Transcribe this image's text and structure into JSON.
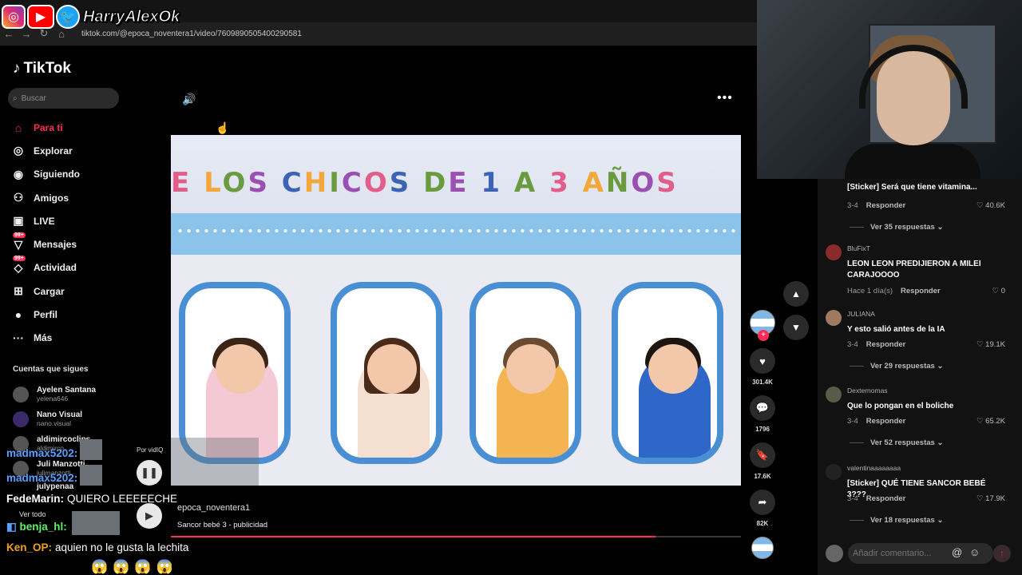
{
  "browser": {
    "url": "tiktok.com/@epoca_noventera1/video/7609890505400290581"
  },
  "overlay": {
    "handle": "HarryAlexOk"
  },
  "tiktok": {
    "logo": "TikTok",
    "search_placeholder": "Buscar",
    "menu": [
      {
        "label": "Para ti",
        "icon": "home-icon"
      },
      {
        "label": "Explorar",
        "icon": "compass-icon"
      },
      {
        "label": "Siguiendo",
        "icon": "following-icon"
      },
      {
        "label": "Amigos",
        "icon": "friends-icon"
      },
      {
        "label": "LIVE",
        "icon": "live-icon"
      },
      {
        "label": "Mensajes",
        "icon": "messages-icon",
        "badge": "99+"
      },
      {
        "label": "Actividad",
        "icon": "activity-icon",
        "badge": "99+"
      },
      {
        "label": "Cargar",
        "icon": "upload-icon"
      },
      {
        "label": "Perfil",
        "icon": "profile-icon"
      },
      {
        "label": "Más",
        "icon": "more-icon"
      }
    ],
    "follows_title": "Cuentas que sigues",
    "follows": [
      {
        "name": "Ayelen Santana",
        "user": "yelena646"
      },
      {
        "name": "Nano Visual",
        "user": "nano.visual"
      },
      {
        "name": "aldimircoclips",
        "user": "aldimirco"
      },
      {
        "name": "Juli Manzotti",
        "user": "julimanzotti"
      },
      {
        "name": "julypenaa",
        "user": "julypenaa"
      }
    ],
    "ver_todo": "Ver todo"
  },
  "video": {
    "title_text": "E LOS CHICOS DE 1 A 3 AÑOS",
    "author": "epoca_noventera1",
    "description": "Sancor bebé 3 - publicidad",
    "progress": 0.85,
    "likes": "301.4K",
    "comments": "1796",
    "saves": "17.6K",
    "shares": "82K"
  },
  "comments": [
    {
      "user": "",
      "text": "[Sticker] Será que tiene vitamina...",
      "meta": "3-4",
      "reply": "Responder",
      "likes": "40.6K",
      "replies": "Ver 35 respuestas"
    },
    {
      "user": "BluFixT",
      "text": "LEON LEON PREDIJIERON A MILEI CARAJOOOO",
      "meta": "Hace 1 día(s)",
      "reply": "Responder",
      "likes": "0",
      "replies": ""
    },
    {
      "user": "JULIANA",
      "text": "Y esto salió antes de la IA",
      "meta": "3-4",
      "reply": "Responder",
      "likes": "19.1K",
      "replies": "Ver 29 respuestas"
    },
    {
      "user": "Dexternomas",
      "text": "Que lo pongan en el boliche",
      "meta": "3-4",
      "reply": "Responder",
      "likes": "65.2K",
      "replies": "Ver 52 respuestas"
    },
    {
      "user": "valentinaaaaaaaa",
      "text": "[Sticker] QUÉ TIENE SANCOR BEBÉ 3???",
      "meta": "3-4",
      "reply": "Responder",
      "likes": "17.9K",
      "replies": "Ver 18 respuestas"
    }
  ],
  "comment_input": {
    "placeholder": "Añadir comentario..."
  },
  "chat": {
    "vidiq": "Por vidIQ",
    "lines": [
      {
        "name": "madmax5202:",
        "msg": "",
        "color": "#5aa0ff"
      },
      {
        "name": "madmax5202:",
        "msg": "",
        "color": "#5aa0ff"
      },
      {
        "name": "FedeMarin:",
        "msg": "QUIERO LEEEEECHE",
        "color": "#ffffff"
      },
      {
        "name": "benja_hl:",
        "msg": "",
        "color": "#5ff06a"
      },
      {
        "name": "Ken_OP:",
        "msg": "aquien no le gusta la lechita",
        "color": "#f0a020"
      }
    ],
    "emotes": "😱😱😱😱"
  }
}
